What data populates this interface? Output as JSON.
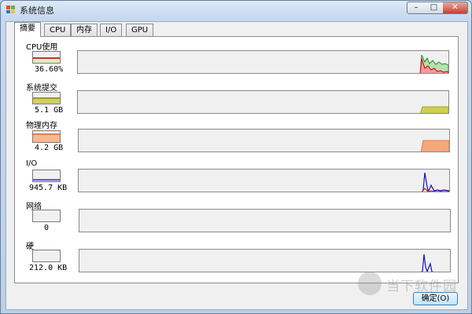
{
  "window": {
    "title": "系统信息"
  },
  "tabs": [
    {
      "label": "摘要",
      "active": true
    },
    {
      "label": "CPU",
      "active": false
    },
    {
      "label": "内存",
      "active": false
    },
    {
      "label": "I/O",
      "active": false
    },
    {
      "label": "GPU",
      "active": false
    }
  ],
  "rows": [
    {
      "label": "CPU使用",
      "value": "36.60%",
      "fill_fraction": 0.33,
      "fill_color": "#d9eec2",
      "fill_accent": "#c33"
    },
    {
      "label": "系统提交",
      "value": "5.1 GB",
      "fill_fraction": 0.35,
      "fill_color": "#d0d060",
      "fill_accent": "#9a9a30"
    },
    {
      "label": "物理内存",
      "value": "4.2 GB",
      "fill_fraction": 0.55,
      "fill_color": "#f8b894",
      "fill_accent": "#e08050"
    },
    {
      "label": "I/O",
      "value": "945.7  KB",
      "fill_fraction": 0.08,
      "fill_color": "#d0d0f0",
      "fill_accent": "#6060c0"
    },
    {
      "label": "网络",
      "value": "0",
      "fill_fraction": 0.0,
      "fill_color": "#ccc",
      "fill_accent": "#888"
    },
    {
      "label": "硬",
      "value": "212.0  KB",
      "fill_fraction": 0.0,
      "fill_color": "#ccc",
      "fill_accent": "#888"
    }
  ],
  "buttons": {
    "ok_label": "确定(O)"
  },
  "watermark": {
    "text": "当下软件园"
  },
  "colors": {
    "cpu_red": "#d00000",
    "cpu_green": "#228b22",
    "io_blue": "#1010c0",
    "commit": "#c8c850",
    "memory": "#f7a87a"
  }
}
